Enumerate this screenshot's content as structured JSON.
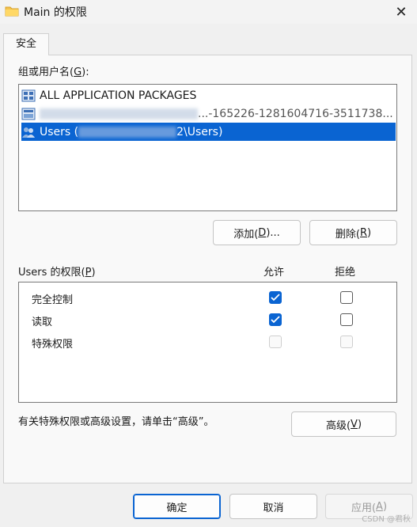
{
  "window": {
    "title": "Main 的权限",
    "close_label": "✕"
  },
  "tabs": [
    {
      "label": "安全"
    }
  ],
  "groups": {
    "label_prefix": "组或用户名(",
    "label_key": "G",
    "label_suffix": "):",
    "items": [
      {
        "name": "ALL APPLICATION PACKAGES",
        "icon": "group-icon"
      },
      {
        "name_visible_tail": "...-165226-1281604716-3511738...",
        "icon": "group-icon"
      },
      {
        "name_prefix": "Users (",
        "name_suffix": "2\\Users)",
        "icon": "users-icon",
        "selected": true
      }
    ]
  },
  "buttons": {
    "add": {
      "prefix": "添加(",
      "key": "D",
      "suffix": ")..."
    },
    "remove": {
      "prefix": "删除(",
      "key": "R",
      "suffix": ")"
    },
    "advanced": {
      "prefix": "高级(",
      "key": "V",
      "suffix": ")"
    },
    "ok": "确定",
    "cancel": "取消",
    "apply": {
      "prefix": "应用(",
      "key": "A",
      "suffix": ")"
    }
  },
  "permissions": {
    "label_prefix": "Users 的权限(",
    "label_key": "P",
    "label_suffix": ")",
    "allow_header": "允许",
    "deny_header": "拒绝",
    "rows": [
      {
        "name": "完全控制",
        "allow": true,
        "deny": false,
        "disabled": false
      },
      {
        "name": "读取",
        "allow": true,
        "deny": false,
        "disabled": false
      },
      {
        "name": "特殊权限",
        "allow": false,
        "deny": false,
        "disabled": true
      }
    ]
  },
  "advanced_hint": "有关特殊权限或高级设置，请单击“高级”。",
  "watermark": "CSDN @君秋",
  "colors": {
    "accent": "#0a64d2",
    "selection": "#0a64d2",
    "window_bg": "#f0f0f0"
  }
}
